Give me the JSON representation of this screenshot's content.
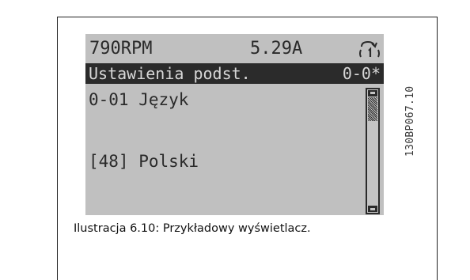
{
  "display": {
    "status": {
      "speed": "790RPM",
      "current": "5.29A",
      "menu_indicator_icon": "hand-menu-1-icon"
    },
    "title_bar": {
      "title": "Ustawienia podst.",
      "code": "0-0*"
    },
    "parameter": {
      "label": "0-01 Język",
      "value": "[48] Polski"
    },
    "scrollbar_icon": "vertical-scrollbar"
  },
  "drawing_reference": "130BP067.10",
  "caption": "Ilustracja 6.10: Przykładowy wyświetlacz."
}
